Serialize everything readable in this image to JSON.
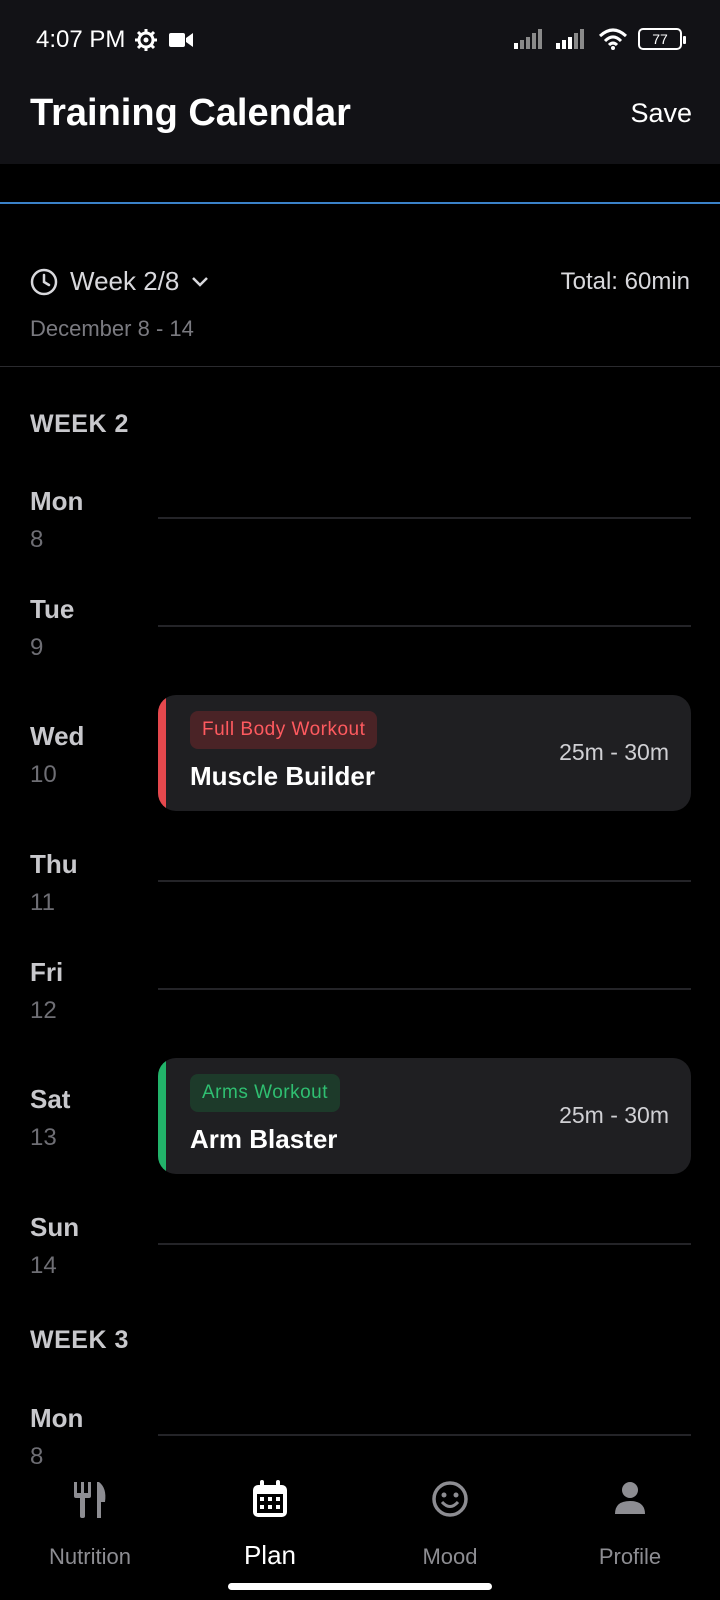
{
  "status_bar": {
    "time": "4:07 PM",
    "battery": "77",
    "icons_left": [
      "gear-icon",
      "video-camera-icon"
    ],
    "icons_right": [
      "signal-icon",
      "signal-icon",
      "wifi-icon",
      "battery-icon"
    ]
  },
  "header": {
    "title": "Training Calendar",
    "save_label": "Save"
  },
  "week_selector": {
    "label": "Week 2/8",
    "date_range": "December 8 - 14",
    "total": "Total: 60min"
  },
  "weeks": [
    {
      "heading": "WEEK 2",
      "days": [
        {
          "name": "Mon",
          "num": "8"
        },
        {
          "name": "Tue",
          "num": "9"
        },
        {
          "name": "Wed",
          "num": "10"
        },
        {
          "name": "Thu",
          "num": "11"
        },
        {
          "name": "Fri",
          "num": "12"
        },
        {
          "name": "Sat",
          "num": "13"
        },
        {
          "name": "Sun",
          "num": "14"
        }
      ]
    },
    {
      "heading": "WEEK 3",
      "days": [
        {
          "name": "Mon",
          "num": "8"
        }
      ]
    }
  ],
  "workouts": [
    {
      "day": "Wed",
      "tag": "Full Body Workout",
      "title": "Muscle Builder",
      "duration": "25m - 30m",
      "accent": "#e5484d",
      "tag_color": "#ff5a5f",
      "tag_bg": "#4a2326"
    },
    {
      "day": "Sat",
      "tag": "Arms Workout",
      "title": "Arm Blaster",
      "duration": "25m - 30m",
      "accent": "#22b36a",
      "tag_color": "#2fbf71",
      "tag_bg": "#1d3a2a"
    }
  ],
  "bottom_nav": [
    {
      "label": "Nutrition",
      "icon": "fork-knife-icon",
      "active": false
    },
    {
      "label": "Plan",
      "icon": "calendar-icon",
      "active": true
    },
    {
      "label": "Mood",
      "icon": "smiley-icon",
      "active": false
    },
    {
      "label": "Profile",
      "icon": "person-icon",
      "active": false
    }
  ]
}
